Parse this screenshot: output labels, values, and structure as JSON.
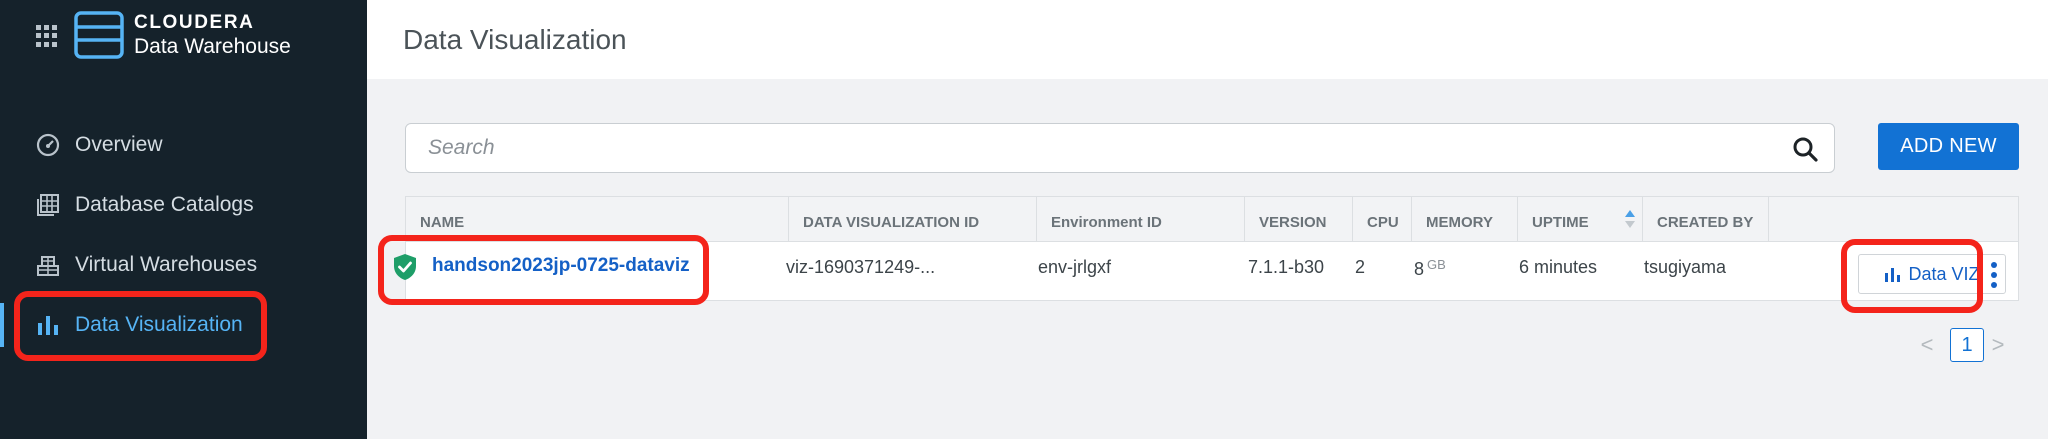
{
  "brand": {
    "company": "CLOUDERA",
    "product": "Data Warehouse"
  },
  "icons": {
    "apps": "apps-grid-icon",
    "logo": "cloudera-logo-icon",
    "search": "search-icon",
    "sort": "sort-icon",
    "status": "shield-check-icon",
    "viz": "bar-chart-icon",
    "kebab": "kebab-menu-icon"
  },
  "sidebar": {
    "items": [
      {
        "label": "Overview",
        "icon": "dashboard-gauge-icon",
        "active": false
      },
      {
        "label": "Database Catalogs",
        "icon": "database-catalog-icon",
        "active": false
      },
      {
        "label": "Virtual Warehouses",
        "icon": "warehouse-icon",
        "active": false
      },
      {
        "label": "Data Visualization",
        "icon": "bar-chart-icon",
        "active": true
      }
    ]
  },
  "header": {
    "title": "Data Visualization"
  },
  "search": {
    "placeholder": "Search",
    "value": ""
  },
  "toolbar": {
    "add_label": "ADD NEW"
  },
  "table": {
    "columns": [
      "NAME",
      "DATA VISUALIZATION ID",
      "Environment ID",
      "VERSION",
      "CPU",
      "MEMORY",
      "UPTIME",
      "CREATED BY"
    ],
    "rows": [
      {
        "name": "handson2023jp-0725-dataviz",
        "viz_id": "viz-1690371249-...",
        "env_id": "env-jrlgxf",
        "version": "7.1.1-b30",
        "cpu": "2",
        "memory": "8",
        "memory_unit": "GB",
        "uptime": "6 minutes",
        "created_by": "tsugiyama",
        "action_label": "Data VIZ"
      }
    ]
  },
  "pagination": {
    "prev": "<",
    "current": "1",
    "next": ">"
  },
  "colors": {
    "sidebar_bg": "#15222b",
    "accent": "#1272d4",
    "link": "#1460c6",
    "active_nav": "#56b4f5",
    "highlight": "#f4241b",
    "status_ok": "#1e9e68"
  }
}
